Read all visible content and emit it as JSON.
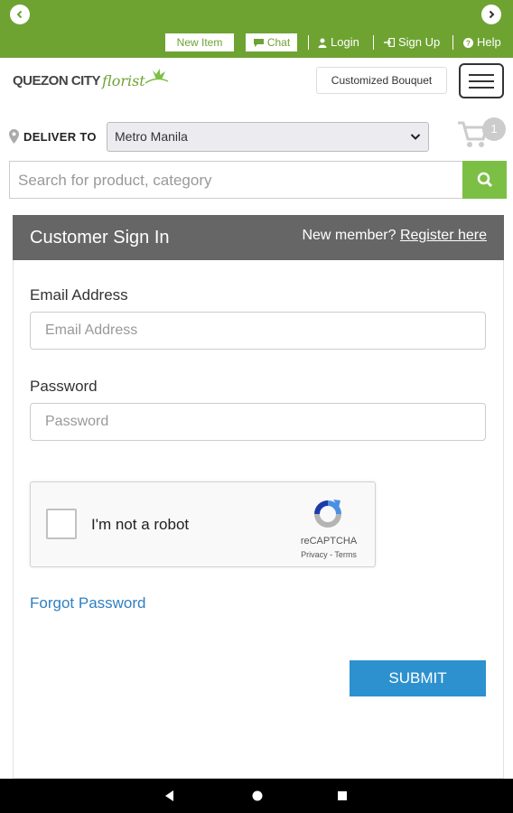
{
  "topbar": {
    "new_item": "New Item",
    "chat": "Chat",
    "login": "Login",
    "sign_up": "Sign Up",
    "help": "Help"
  },
  "header": {
    "logo_main": "QUEZON CITY",
    "logo_script": "florist",
    "customized_bouquet": "Customized Bouquet",
    "deliver_label": "DELIVER TO",
    "region_selected": "Metro Manila",
    "cart_count": "1",
    "search_placeholder": "Search for product, category"
  },
  "signin": {
    "title": "Customer Sign In",
    "new_member_text": "New member?",
    "register_link": "Register here",
    "email_label": "Email Address",
    "email_placeholder": "Email Address",
    "password_label": "Password",
    "password_placeholder": "Password",
    "captcha_text": "I'm not a robot",
    "captcha_brand": "reCAPTCHA",
    "captcha_links": "Privacy - Terms",
    "forgot_password": "Forgot Password",
    "submit": "SUBMIT"
  },
  "colors": {
    "brand_green": "#6ea332",
    "search_green": "#7cbf45",
    "header_gray": "#666666",
    "submit_blue": "#2d91cf",
    "link_blue": "#2f7fc1"
  },
  "icons": [
    "chevron-left-icon",
    "chevron-right-icon",
    "chat-icon",
    "user-icon",
    "sign-in-icon",
    "help-icon",
    "menu-icon",
    "map-pin-icon",
    "chevron-down-icon",
    "cart-icon",
    "search-icon",
    "recaptcha-icon",
    "back-icon",
    "home-icon",
    "recents-icon"
  ]
}
